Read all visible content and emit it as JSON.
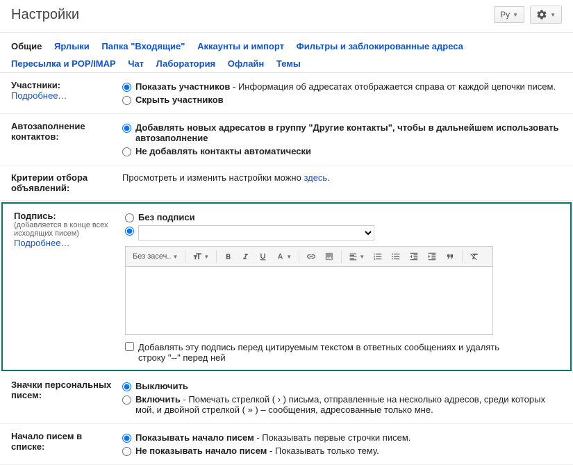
{
  "header": {
    "title": "Настройки",
    "lang": "Ру"
  },
  "tabs": [
    "Общие",
    "Ярлыки",
    "Папка \"Входящие\"",
    "Аккаунты и импорт",
    "Фильтры и заблокированные адреса",
    "Пересылка и POP/IMAP",
    "Чат",
    "Лаборатория",
    "Офлайн",
    "Темы"
  ],
  "sections": {
    "participants": {
      "title": "Участники:",
      "link": "Подробнее…",
      "opt1_label": "Показать участников",
      "opt1_desc": " - Информация об адресатах отображается справа от каждой цепочки писем.",
      "opt2_label": "Скрыть участников"
    },
    "autocomplete": {
      "title": "Автозаполнение контактов:",
      "opt1": "Добавлять новых адресатов в группу \"Другие контакты\", чтобы в дальнейшем использовать автозаполнение",
      "opt2": "Не добавлять контакты автоматически"
    },
    "criteria": {
      "title": "Критерии отбора объявлений:",
      "text": "Просмотреть и изменить настройки можно ",
      "link": "здесь",
      "dot": "."
    },
    "signature": {
      "title": "Подпись:",
      "note": "(добавляется в конце всех исходящих писем)",
      "link": "Подробнее…",
      "opt1": "Без подписи",
      "font_label": "Без засеч..",
      "checkbox": "Добавлять эту подпись перед цитируемым текстом в ответных сообщениях и удалять строку \"--\" перед ней"
    },
    "indicators": {
      "title": "Значки персональных писем:",
      "opt1_label": "Выключить",
      "opt2_label": "Включить",
      "opt2_desc": " - Помечать стрелкой ( › ) письма, отправленные на несколько адресов, среди которых мой, и двойной стрелкой ( » ) – сообщения, адресованные только мне."
    },
    "snippets": {
      "title": "Начало писем в списке:",
      "opt1_label": "Показывать начало писем",
      "opt1_desc": " - Показывать первые строчки писем.",
      "opt2_label": "Не показывать начало писем",
      "opt2_desc": " - Показывать только тему."
    }
  }
}
